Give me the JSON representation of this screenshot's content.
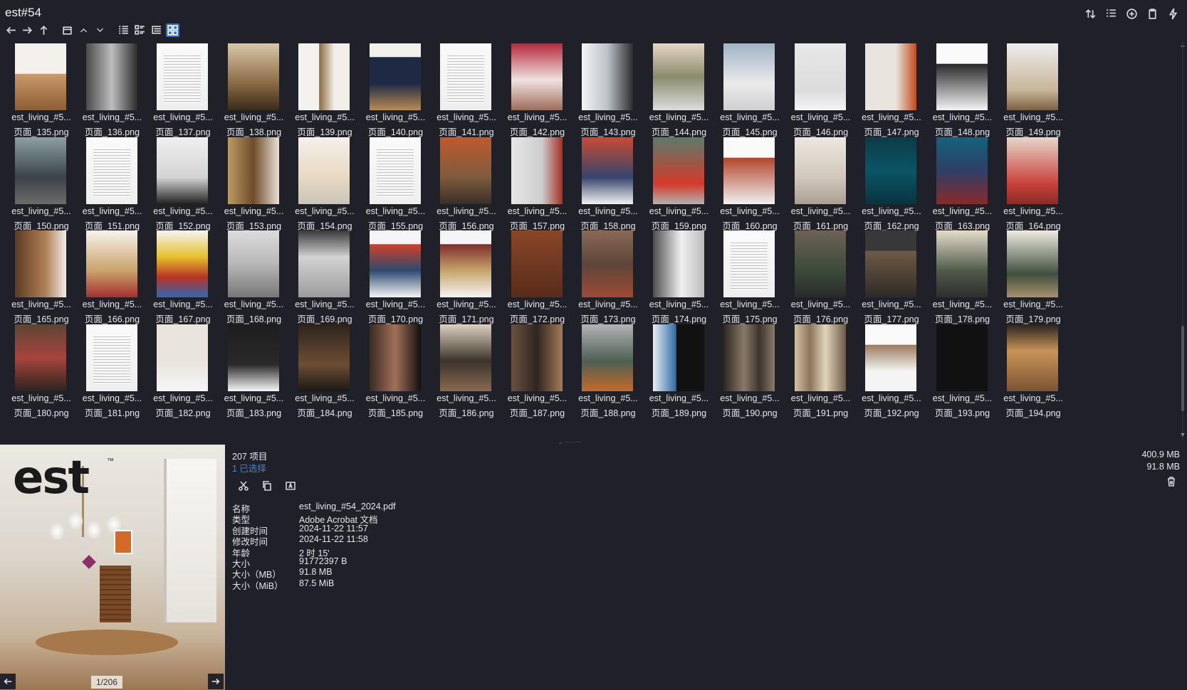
{
  "window": {
    "title": "est#54"
  },
  "toolbar": {
    "nav_icons": [
      "arrow-left-icon",
      "arrow-right-icon",
      "arrow-up-icon",
      "folder-icon",
      "chevron-up-icon",
      "chevron-down-icon",
      "list-view-icon",
      "details-view-icon",
      "tree-view-icon",
      "grid-view-icon"
    ],
    "right_icons": [
      "sort-icon",
      "list-options-icon",
      "add-icon",
      "clipboard-icon",
      "flash-icon"
    ]
  },
  "grid": {
    "columns": 15,
    "items": [
      {
        "name": "est_living_#5...",
        "page": "页面_135.png"
      },
      {
        "name": "est_living_#5...",
        "page": "页面_136.png"
      },
      {
        "name": "est_living_#5...",
        "page": "页面_137.png"
      },
      {
        "name": "est_living_#5...",
        "page": "页面_138.png"
      },
      {
        "name": "est_living_#5...",
        "page": "页面_139.png"
      },
      {
        "name": "est_living_#5...",
        "page": "页面_140.png"
      },
      {
        "name": "est_living_#5...",
        "page": "页面_141.png"
      },
      {
        "name": "est_living_#5...",
        "page": "页面_142.png"
      },
      {
        "name": "est_living_#5...",
        "page": "页面_143.png"
      },
      {
        "name": "est_living_#5...",
        "page": "页面_144.png"
      },
      {
        "name": "est_living_#5...",
        "page": "页面_145.png"
      },
      {
        "name": "est_living_#5...",
        "page": "页面_146.png"
      },
      {
        "name": "est_living_#5...",
        "page": "页面_147.png"
      },
      {
        "name": "est_living_#5...",
        "page": "页面_148.png"
      },
      {
        "name": "est_living_#5...",
        "page": "页面_149.png"
      },
      {
        "name": "est_living_#5...",
        "page": "页面_150.png"
      },
      {
        "name": "est_living_#5...",
        "page": "页面_151.png"
      },
      {
        "name": "est_living_#5...",
        "page": "页面_152.png"
      },
      {
        "name": "est_living_#5...",
        "page": "页面_153.png"
      },
      {
        "name": "est_living_#5...",
        "page": "页面_154.png"
      },
      {
        "name": "est_living_#5...",
        "page": "页面_155.png"
      },
      {
        "name": "est_living_#5...",
        "page": "页面_156.png"
      },
      {
        "name": "est_living_#5...",
        "page": "页面_157.png"
      },
      {
        "name": "est_living_#5...",
        "page": "页面_158.png"
      },
      {
        "name": "est_living_#5...",
        "page": "页面_159.png"
      },
      {
        "name": "est_living_#5...",
        "page": "页面_160.png"
      },
      {
        "name": "est_living_#5...",
        "page": "页面_161.png"
      },
      {
        "name": "est_living_#5...",
        "page": "页面_162.png"
      },
      {
        "name": "est_living_#5...",
        "page": "页面_163.png"
      },
      {
        "name": "est_living_#5...",
        "page": "页面_164.png"
      },
      {
        "name": "est_living_#5...",
        "page": "页面_165.png"
      },
      {
        "name": "est_living_#5...",
        "page": "页面_166.png"
      },
      {
        "name": "est_living_#5...",
        "page": "页面_167.png"
      },
      {
        "name": "est_living_#5...",
        "page": "页面_168.png"
      },
      {
        "name": "est_living_#5...",
        "page": "页面_169.png"
      },
      {
        "name": "est_living_#5...",
        "page": "页面_170.png"
      },
      {
        "name": "est_living_#5...",
        "page": "页面_171.png"
      },
      {
        "name": "est_living_#5...",
        "page": "页面_172.png"
      },
      {
        "name": "est_living_#5...",
        "page": "页面_173.png"
      },
      {
        "name": "est_living_#5...",
        "page": "页面_174.png"
      },
      {
        "name": "est_living_#5...",
        "page": "页面_175.png"
      },
      {
        "name": "est_living_#5...",
        "page": "页面_176.png"
      },
      {
        "name": "est_living_#5...",
        "page": "页面_177.png"
      },
      {
        "name": "est_living_#5...",
        "page": "页面_178.png"
      },
      {
        "name": "est_living_#5...",
        "page": "页面_179.png"
      },
      {
        "name": "est_living_#5...",
        "page": "页面_180.png"
      },
      {
        "name": "est_living_#5...",
        "page": "页面_181.png"
      },
      {
        "name": "est_living_#5...",
        "page": "页面_182.png"
      },
      {
        "name": "est_living_#5...",
        "page": "页面_183.png"
      },
      {
        "name": "est_living_#5...",
        "page": "页面_184.png"
      },
      {
        "name": "est_living_#5...",
        "page": "页面_185.png"
      },
      {
        "name": "est_living_#5...",
        "page": "页面_186.png"
      },
      {
        "name": "est_living_#5...",
        "page": "页面_187.png"
      },
      {
        "name": "est_living_#5...",
        "page": "页面_188.png"
      },
      {
        "name": "est_living_#5...",
        "page": "页面_189.png"
      },
      {
        "name": "est_living_#5...",
        "page": "页面_190.png"
      },
      {
        "name": "est_living_#5...",
        "page": "页面_191.png"
      },
      {
        "name": "est_living_#5...",
        "page": "页面_192.png"
      },
      {
        "name": "est_living_#5...",
        "page": "页面_193.png"
      },
      {
        "name": "est_living_#5...",
        "page": "页面_194.png"
      }
    ]
  },
  "preview": {
    "logo_text": "est",
    "logo_mark": "™",
    "pager": "1/206",
    "prev_icon": "arrow-left-icon",
    "next_icon": "arrow-right-icon"
  },
  "info": {
    "count": "207 项目",
    "selected": "1 已选择",
    "action_icons": [
      "cut-icon",
      "copy-icon",
      "rename-icon"
    ],
    "properties": [
      {
        "label": "名称",
        "value": "est_living_#54_2024.pdf"
      },
      {
        "label": "类型",
        "value": "Adobe Acrobat 文档"
      },
      {
        "label": "创建时间",
        "value": "2024-11-22  11:57"
      },
      {
        "label": "修改时间",
        "value": "2024-11-22  11:58"
      },
      {
        "label": "年龄",
        "value": "2 时 15'"
      },
      {
        "label": "大小",
        "value": "91772397 B"
      },
      {
        "label": "大小（MB）",
        "value": "91.8 MB"
      },
      {
        "label": "大小（MiB）",
        "value": "87.5 MiB"
      }
    ],
    "total_size": "400.9 MB",
    "selected_size": "91.8 MB",
    "trash_icon": "trash-icon"
  }
}
